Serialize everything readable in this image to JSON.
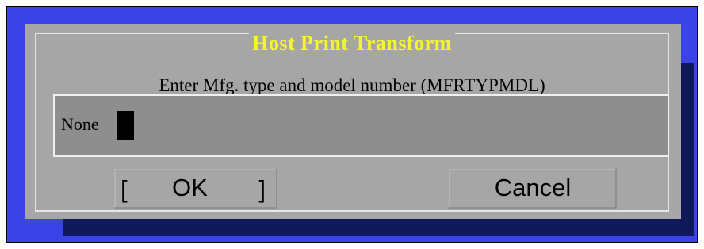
{
  "dialog": {
    "title": "Host Print Transform",
    "prompt": "Enter Mfg. type and model number (MFRTYPMDL)",
    "field": {
      "value": "None"
    },
    "buttons": {
      "ok": {
        "left_bracket": "[",
        "label": "OK",
        "right_bracket": "]"
      },
      "cancel": {
        "label": "Cancel"
      }
    }
  },
  "colors": {
    "screen_background": "#3a43e8",
    "dialog_shadow": "#11185a",
    "dialog_background": "#a6a6a6",
    "input_background": "#8e8e8e",
    "title_text": "#f4f52c"
  }
}
